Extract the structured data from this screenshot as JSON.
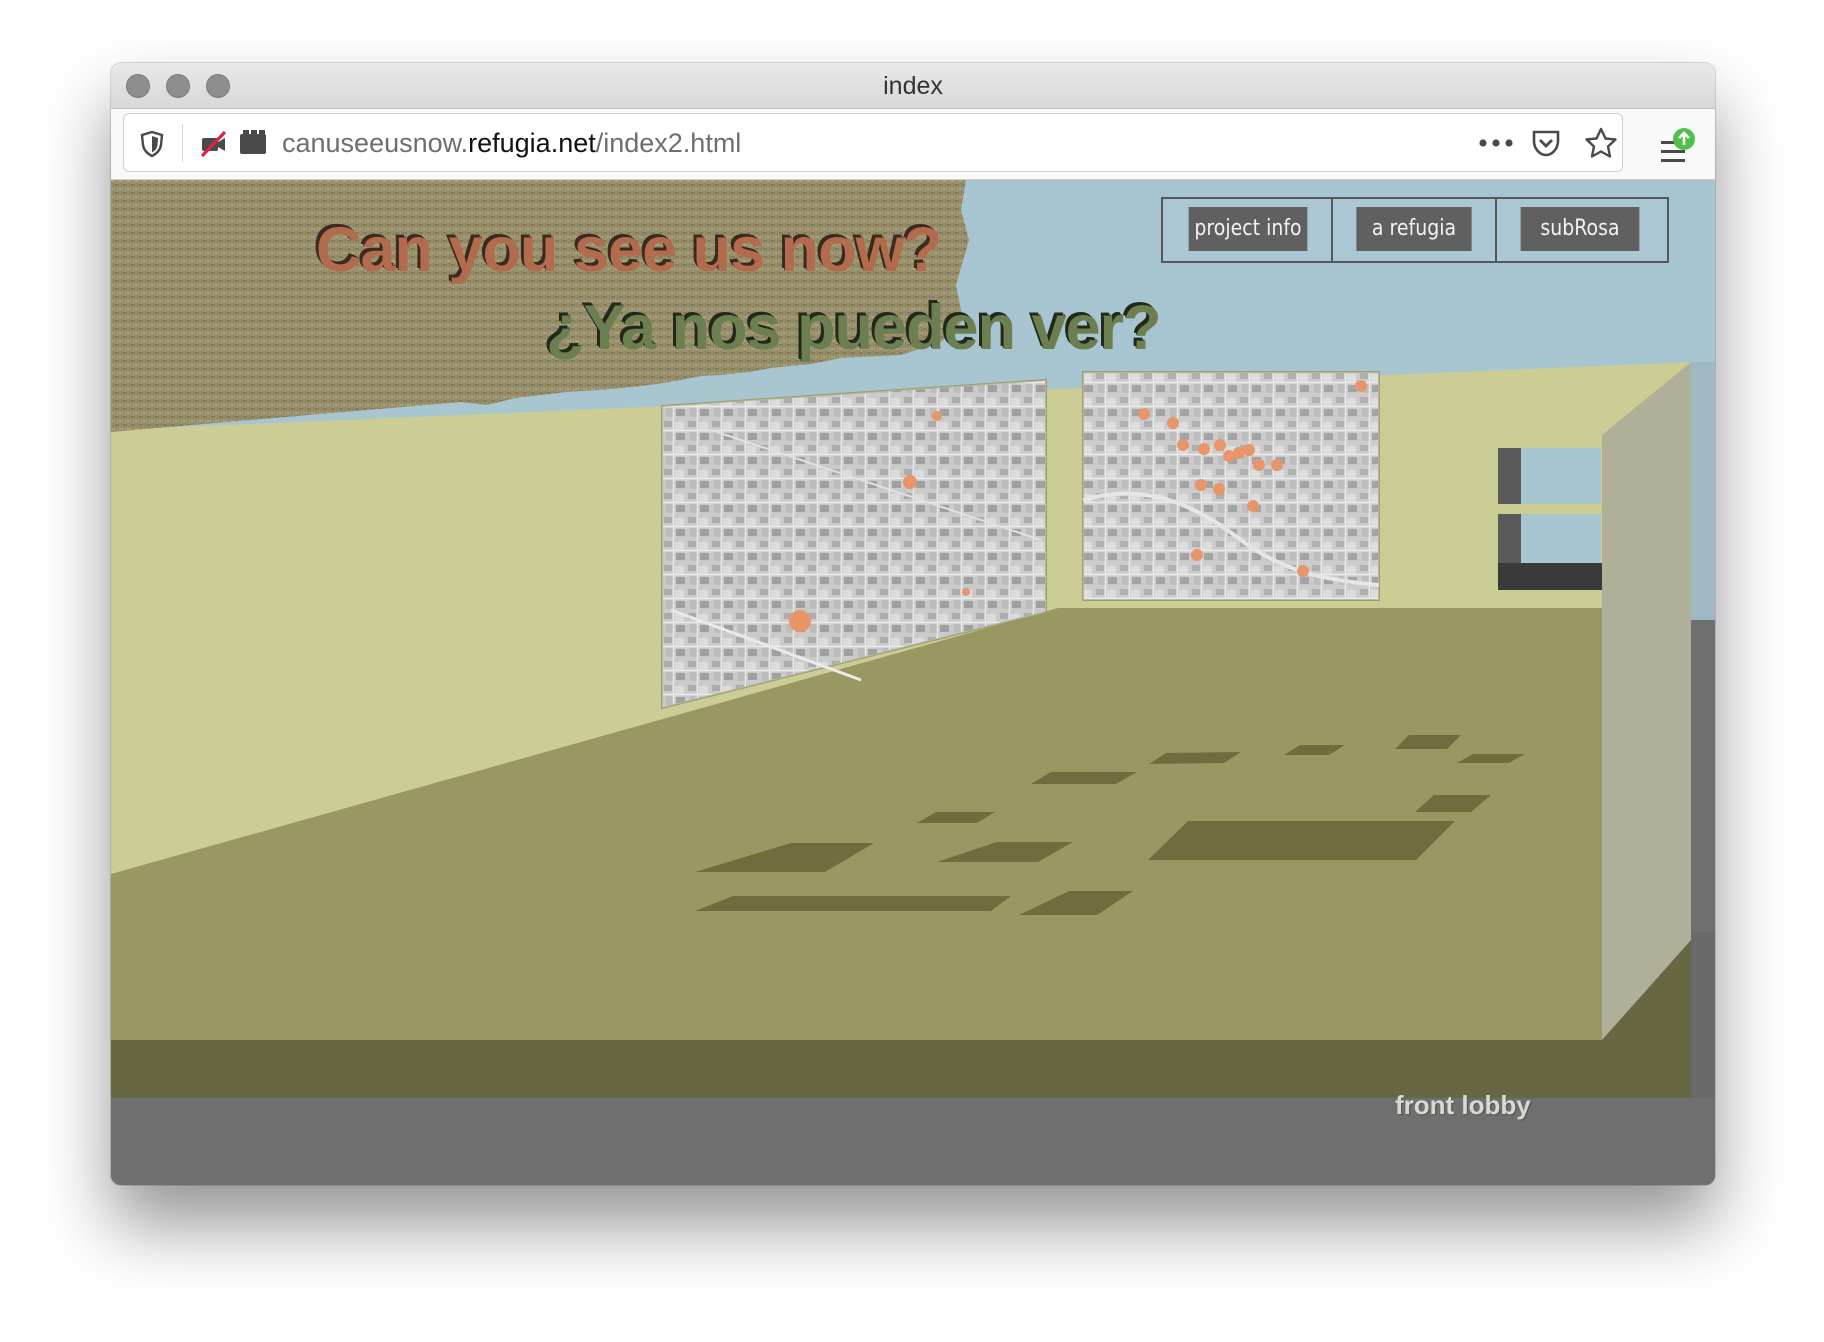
{
  "window": {
    "title": "index"
  },
  "browser": {
    "url_prefix": "canuseeusnow.",
    "url_domain": "refugia.net",
    "url_path": "/index2.html",
    "icons": [
      "shield-icon",
      "camera-blocked-icon",
      "media-icon",
      "more-dots-icon",
      "pocket-icon",
      "star-icon",
      "menu-icon",
      "update-badge-icon"
    ]
  },
  "page": {
    "title_en": "Can you see us now?",
    "title_es": "¿Ya nos pueden ver?",
    "nav": [
      {
        "label": "project info"
      },
      {
        "label": "a refugia"
      },
      {
        "label": "subRosa"
      }
    ],
    "room_label": "front lobby",
    "maps": [
      {
        "markers": [
          "1",
          "11",
          "13"
        ]
      },
      {
        "markers": [
          "10",
          "12",
          "15",
          "7",
          "4",
          "5",
          "2",
          "3",
          "16",
          "11",
          "13",
          "8",
          "17",
          "6",
          "9",
          "5"
        ]
      }
    ]
  },
  "colors": {
    "sky": "#a6c5d1",
    "wall": "#cccc95",
    "floor": "#9a9862",
    "floor_edge": "#676743",
    "burlap": "#988f6c",
    "title_en": "#b36b4d",
    "title_es": "#6c7f50",
    "nav_button": "#606060",
    "map_marker": "#e8956a"
  }
}
